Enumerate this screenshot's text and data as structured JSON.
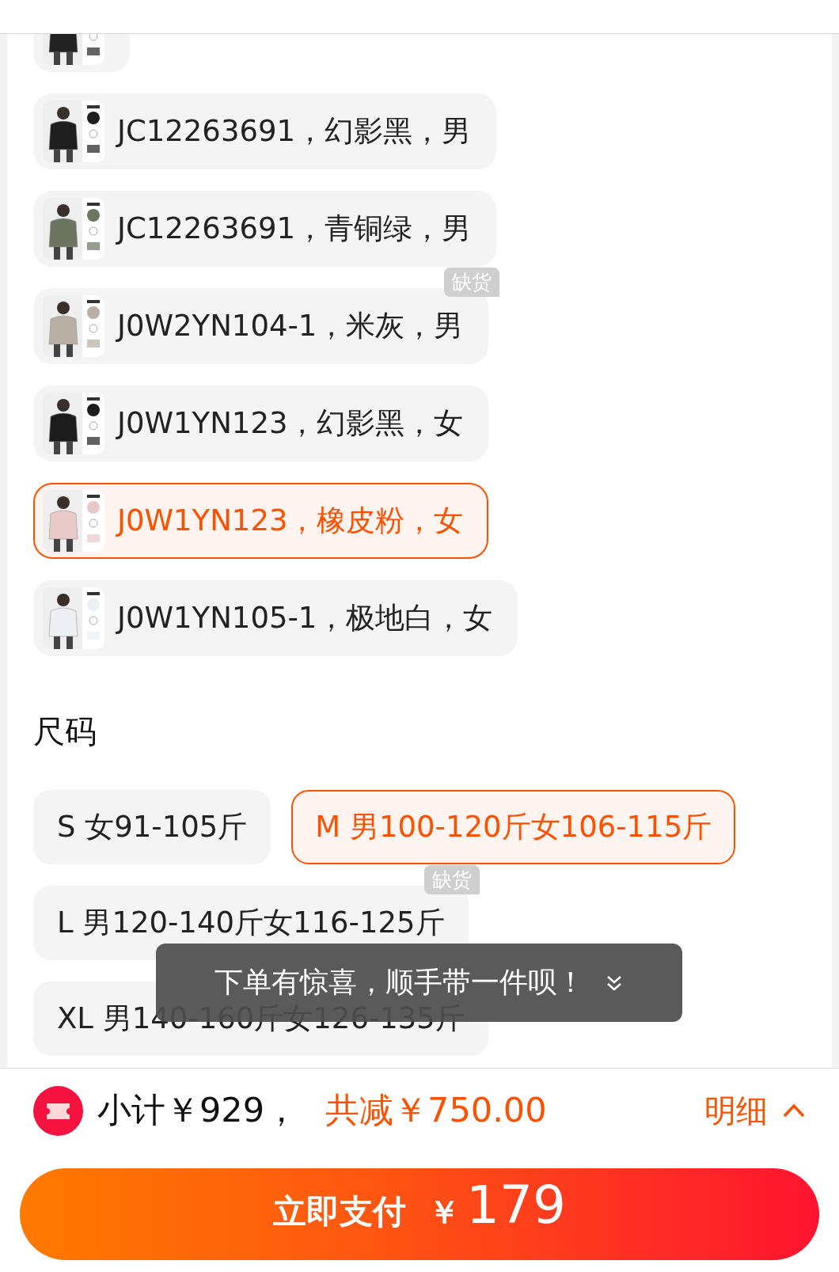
{
  "colors": [
    {
      "selected": false,
      "out_of_stock": false
    },
    {
      "label": "JC12263691，幻影黑，男",
      "selected": false,
      "out_of_stock": false
    },
    {
      "label": "JC12263691，青铜绿，男",
      "selected": false,
      "out_of_stock": false
    },
    {
      "label": "J0W2YN104-1，米灰，男",
      "selected": false,
      "out_of_stock": true,
      "badge": "缺货"
    },
    {
      "label": "J0W1YN123，幻影黑，女",
      "selected": false,
      "out_of_stock": false
    },
    {
      "label": "J0W1YN123，橡皮粉，女",
      "selected": true,
      "out_of_stock": false
    },
    {
      "label": "J0W1YN105-1，极地白，女",
      "selected": false,
      "out_of_stock": false
    }
  ],
  "size_heading": "尺码",
  "sizes": [
    {
      "label": "S 女91-105斤",
      "selected": false,
      "out_of_stock": false
    },
    {
      "label": "M 男100-120斤女106-115斤",
      "selected": true,
      "out_of_stock": false
    },
    {
      "label": "L 男120-140斤女116-125斤",
      "selected": false,
      "out_of_stock": true,
      "badge": "缺货"
    },
    {
      "label": "XL 男140-160斤女126-135斤",
      "selected": false,
      "out_of_stock": false
    }
  ],
  "toast": {
    "text": "下单有惊喜，顺手带一件呗！"
  },
  "summary": {
    "subtotal": "小计￥929，",
    "discount": "共减￥750.00",
    "details": "明细"
  },
  "pay_button": {
    "label": "立即支付",
    "currency": "￥",
    "amount": "179"
  }
}
